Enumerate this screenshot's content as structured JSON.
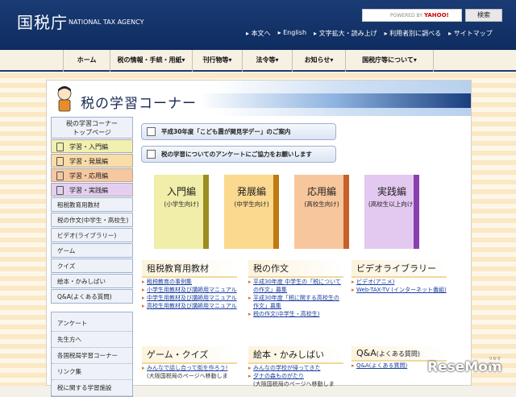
{
  "header": {
    "logo": "国税庁",
    "logo_en": "NATIONAL TAX AGENCY",
    "search": {
      "placeholder_prefix": "POWERED BY",
      "placeholder_brand": "YAHOO!",
      "button": "検索"
    },
    "utility": [
      "本文へ",
      "English",
      "文字拡大・読み上げ",
      "利用者別に調べる",
      "サイトマップ"
    ]
  },
  "gnav": [
    "ホーム",
    "税の情報・手続・用紙",
    "刊行物等",
    "法令等",
    "お知らせ",
    "国税庁等について"
  ],
  "corner": {
    "title": "税の学習コーナー"
  },
  "sidenav": {
    "top_line1": "税の学習コーナー",
    "top_line2": "トップページ",
    "categories": [
      {
        "label": "学習・入門編",
        "color": "#f2f0b0"
      },
      {
        "label": "学習・発展編",
        "color": "#f9dca8"
      },
      {
        "label": "学習・応用編",
        "color": "#f7c7a0"
      },
      {
        "label": "学習・実践編",
        "color": "#e4cff0"
      }
    ],
    "links": [
      "租税教育用教材",
      "税の作文(中学生・高校生)",
      "ビデオ(ライブラリー)",
      "ゲーム",
      "クイズ",
      "絵本・かみしばい",
      "Q&A(よくある質問)"
    ],
    "links2": [
      "アンケート",
      "先生方へ",
      "各国税局学習コーナー",
      "リンク集",
      "税に関する学習施設"
    ]
  },
  "notices": [
    "平成30年度「こども霞が関見学デー」のご案内",
    "税の学習についてのアンケートにご協力をお願いします"
  ],
  "books": [
    {
      "title": "入門編",
      "sub": "(小学生向け)",
      "color": "#f0eea8",
      "spine": "#9a8e20"
    },
    {
      "title": "発展編",
      "sub": "(中学生向け)",
      "color": "#fbd98e",
      "spine": "#c07a10"
    },
    {
      "title": "応用編",
      "sub": "(高校生向け)",
      "color": "#f8c69c",
      "spine": "#c8602a"
    },
    {
      "title": "実践編",
      "sub": "(高校生以上向け)",
      "color": "#e3c8ef",
      "spine": "#8a3fb0"
    }
  ],
  "sections": {
    "kyozai": {
      "title": "租税教育用教材",
      "items": [
        "租税教育の事例集",
        "小学生用教材及び講師用マニュアル",
        "中学生用教材及び講師用マニュアル",
        "高校生用教材及び講師用マニュアル"
      ]
    },
    "sakubun": {
      "title": "税の作文",
      "items": [
        "平成30年度 中学生の「税についての作文」募集",
        "平成30年度「税に関する高校生の作文」募集",
        "税の作文(中学生・高校生)"
      ]
    },
    "video": {
      "title": "ビデオライブラリー",
      "items": [
        "ビデオ(アニメ)",
        "Web-TAX-TV (インターネット番組)"
      ]
    },
    "game": {
      "title": "ゲーム・クイズ",
      "items": [
        "みんなで話し合って街を作ろう!"
      ],
      "note": "(大阪国税局のページへ移動しま"
    },
    "ehon": {
      "title": "絵本・かみしばい",
      "items": [
        "みんなの学校が帰ってきた",
        "ダナの森ものがたり"
      ],
      "note": "(大阪国税局のページへ移動しま"
    },
    "qa": {
      "title": "Q&A",
      "title_sub": "(よくある質問)",
      "items": [
        "Q&A(よくある質問)"
      ]
    }
  },
  "watermark": {
    "text": "ReseMom",
    "small": "リセマム"
  }
}
